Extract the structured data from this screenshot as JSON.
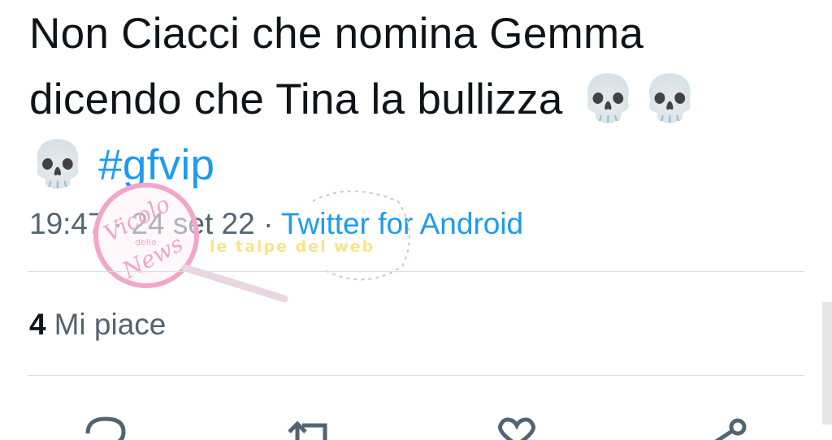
{
  "tweet": {
    "text_line1": "Non Ciacci che nomina Gemma",
    "text_line2": "dicendo che Tina la bullizza",
    "emoji": "💀",
    "hashtag": "#gfvip",
    "time": "19:47",
    "separator": "·",
    "date": "24 set 22",
    "source": "Twitter for Android",
    "likes_count": "4",
    "likes_label": "Mi piace"
  },
  "watermark": {
    "brand_line1": "Vicolo",
    "brand_line2": "delle",
    "brand_line3": "News",
    "tagline": "le talpe del web"
  },
  "actions": {
    "reply_icon": "reply-icon",
    "retweet_icon": "retweet-icon",
    "like_icon": "heart-icon",
    "share_icon": "share-icon"
  },
  "colors": {
    "text": "#0f1419",
    "secondary": "#536471",
    "link": "#1d9bf0",
    "divider": "#dadfe3",
    "watermark_pink": "#f2a6c9"
  }
}
